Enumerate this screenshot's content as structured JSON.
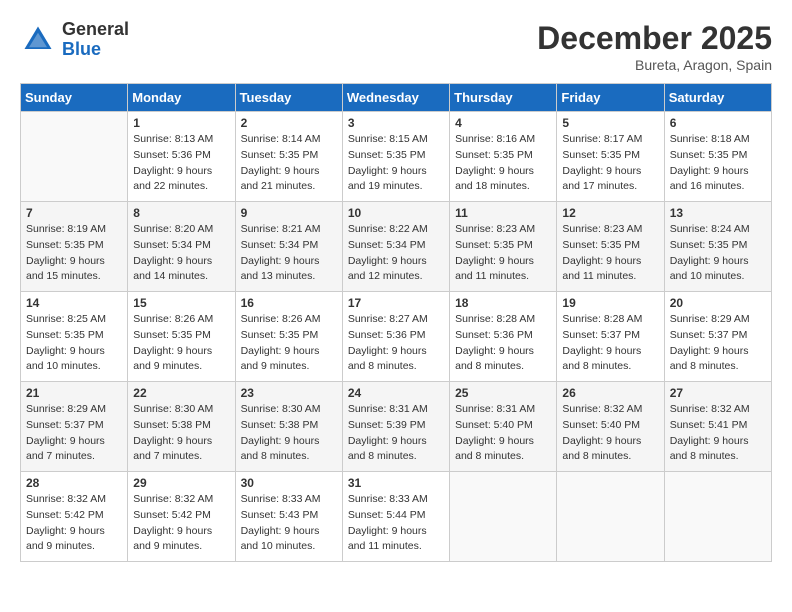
{
  "header": {
    "logo_general": "General",
    "logo_blue": "Blue",
    "month": "December 2025",
    "location": "Bureta, Aragon, Spain"
  },
  "days_of_week": [
    "Sunday",
    "Monday",
    "Tuesday",
    "Wednesday",
    "Thursday",
    "Friday",
    "Saturday"
  ],
  "weeks": [
    [
      {
        "day": "",
        "sunrise": "",
        "sunset": "",
        "daylight": ""
      },
      {
        "day": "1",
        "sunrise": "Sunrise: 8:13 AM",
        "sunset": "Sunset: 5:36 PM",
        "daylight": "Daylight: 9 hours and 22 minutes."
      },
      {
        "day": "2",
        "sunrise": "Sunrise: 8:14 AM",
        "sunset": "Sunset: 5:35 PM",
        "daylight": "Daylight: 9 hours and 21 minutes."
      },
      {
        "day": "3",
        "sunrise": "Sunrise: 8:15 AM",
        "sunset": "Sunset: 5:35 PM",
        "daylight": "Daylight: 9 hours and 19 minutes."
      },
      {
        "day": "4",
        "sunrise": "Sunrise: 8:16 AM",
        "sunset": "Sunset: 5:35 PM",
        "daylight": "Daylight: 9 hours and 18 minutes."
      },
      {
        "day": "5",
        "sunrise": "Sunrise: 8:17 AM",
        "sunset": "Sunset: 5:35 PM",
        "daylight": "Daylight: 9 hours and 17 minutes."
      },
      {
        "day": "6",
        "sunrise": "Sunrise: 8:18 AM",
        "sunset": "Sunset: 5:35 PM",
        "daylight": "Daylight: 9 hours and 16 minutes."
      }
    ],
    [
      {
        "day": "7",
        "sunrise": "Sunrise: 8:19 AM",
        "sunset": "Sunset: 5:35 PM",
        "daylight": "Daylight: 9 hours and 15 minutes."
      },
      {
        "day": "8",
        "sunrise": "Sunrise: 8:20 AM",
        "sunset": "Sunset: 5:34 PM",
        "daylight": "Daylight: 9 hours and 14 minutes."
      },
      {
        "day": "9",
        "sunrise": "Sunrise: 8:21 AM",
        "sunset": "Sunset: 5:34 PM",
        "daylight": "Daylight: 9 hours and 13 minutes."
      },
      {
        "day": "10",
        "sunrise": "Sunrise: 8:22 AM",
        "sunset": "Sunset: 5:34 PM",
        "daylight": "Daylight: 9 hours and 12 minutes."
      },
      {
        "day": "11",
        "sunrise": "Sunrise: 8:23 AM",
        "sunset": "Sunset: 5:35 PM",
        "daylight": "Daylight: 9 hours and 11 minutes."
      },
      {
        "day": "12",
        "sunrise": "Sunrise: 8:23 AM",
        "sunset": "Sunset: 5:35 PM",
        "daylight": "Daylight: 9 hours and 11 minutes."
      },
      {
        "day": "13",
        "sunrise": "Sunrise: 8:24 AM",
        "sunset": "Sunset: 5:35 PM",
        "daylight": "Daylight: 9 hours and 10 minutes."
      }
    ],
    [
      {
        "day": "14",
        "sunrise": "Sunrise: 8:25 AM",
        "sunset": "Sunset: 5:35 PM",
        "daylight": "Daylight: 9 hours and 10 minutes."
      },
      {
        "day": "15",
        "sunrise": "Sunrise: 8:26 AM",
        "sunset": "Sunset: 5:35 PM",
        "daylight": "Daylight: 9 hours and 9 minutes."
      },
      {
        "day": "16",
        "sunrise": "Sunrise: 8:26 AM",
        "sunset": "Sunset: 5:35 PM",
        "daylight": "Daylight: 9 hours and 9 minutes."
      },
      {
        "day": "17",
        "sunrise": "Sunrise: 8:27 AM",
        "sunset": "Sunset: 5:36 PM",
        "daylight": "Daylight: 9 hours and 8 minutes."
      },
      {
        "day": "18",
        "sunrise": "Sunrise: 8:28 AM",
        "sunset": "Sunset: 5:36 PM",
        "daylight": "Daylight: 9 hours and 8 minutes."
      },
      {
        "day": "19",
        "sunrise": "Sunrise: 8:28 AM",
        "sunset": "Sunset: 5:37 PM",
        "daylight": "Daylight: 9 hours and 8 minutes."
      },
      {
        "day": "20",
        "sunrise": "Sunrise: 8:29 AM",
        "sunset": "Sunset: 5:37 PM",
        "daylight": "Daylight: 9 hours and 8 minutes."
      }
    ],
    [
      {
        "day": "21",
        "sunrise": "Sunrise: 8:29 AM",
        "sunset": "Sunset: 5:37 PM",
        "daylight": "Daylight: 9 hours and 7 minutes."
      },
      {
        "day": "22",
        "sunrise": "Sunrise: 8:30 AM",
        "sunset": "Sunset: 5:38 PM",
        "daylight": "Daylight: 9 hours and 7 minutes."
      },
      {
        "day": "23",
        "sunrise": "Sunrise: 8:30 AM",
        "sunset": "Sunset: 5:38 PM",
        "daylight": "Daylight: 9 hours and 8 minutes."
      },
      {
        "day": "24",
        "sunrise": "Sunrise: 8:31 AM",
        "sunset": "Sunset: 5:39 PM",
        "daylight": "Daylight: 9 hours and 8 minutes."
      },
      {
        "day": "25",
        "sunrise": "Sunrise: 8:31 AM",
        "sunset": "Sunset: 5:40 PM",
        "daylight": "Daylight: 9 hours and 8 minutes."
      },
      {
        "day": "26",
        "sunrise": "Sunrise: 8:32 AM",
        "sunset": "Sunset: 5:40 PM",
        "daylight": "Daylight: 9 hours and 8 minutes."
      },
      {
        "day": "27",
        "sunrise": "Sunrise: 8:32 AM",
        "sunset": "Sunset: 5:41 PM",
        "daylight": "Daylight: 9 hours and 8 minutes."
      }
    ],
    [
      {
        "day": "28",
        "sunrise": "Sunrise: 8:32 AM",
        "sunset": "Sunset: 5:42 PM",
        "daylight": "Daylight: 9 hours and 9 minutes."
      },
      {
        "day": "29",
        "sunrise": "Sunrise: 8:32 AM",
        "sunset": "Sunset: 5:42 PM",
        "daylight": "Daylight: 9 hours and 9 minutes."
      },
      {
        "day": "30",
        "sunrise": "Sunrise: 8:33 AM",
        "sunset": "Sunset: 5:43 PM",
        "daylight": "Daylight: 9 hours and 10 minutes."
      },
      {
        "day": "31",
        "sunrise": "Sunrise: 8:33 AM",
        "sunset": "Sunset: 5:44 PM",
        "daylight": "Daylight: 9 hours and 11 minutes."
      },
      {
        "day": "",
        "sunrise": "",
        "sunset": "",
        "daylight": ""
      },
      {
        "day": "",
        "sunrise": "",
        "sunset": "",
        "daylight": ""
      },
      {
        "day": "",
        "sunrise": "",
        "sunset": "",
        "daylight": ""
      }
    ]
  ]
}
